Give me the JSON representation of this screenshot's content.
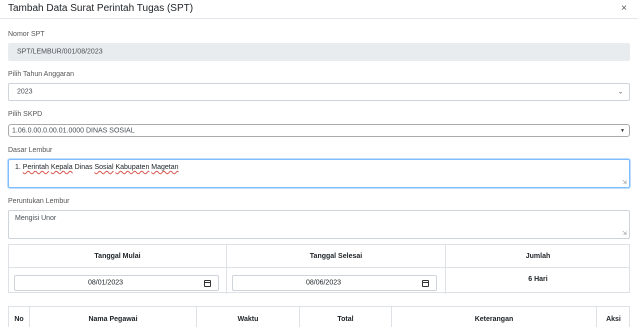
{
  "modal": {
    "title": "Tambah Data Surat Perintah Tugas (SPT)",
    "close_icon": "×"
  },
  "nomor_spt": {
    "label": "Nomor SPT",
    "value": "SPT/LEMBUR/001/08/2023"
  },
  "tahun_anggaran": {
    "label": "Pilih Tahun Anggaran",
    "value": "2023"
  },
  "skpd": {
    "label": "Pilih SKPD",
    "value": "1.06.0.00.0.00.01.0000 DINAS SOSIAL"
  },
  "dasar_lembur": {
    "label": "Dasar Lembur",
    "prefix": "1.",
    "words": [
      "Perintah",
      "Kepala",
      "Dinas",
      "Sosial",
      "Kabupaten",
      "Magetan"
    ]
  },
  "peruntukan_lembur": {
    "label": "Peruntukan Lembur",
    "value": "Mengisi Unor"
  },
  "date_table": {
    "headers": {
      "mulai": "Tanggal Mulai",
      "selesai": "Tanggal Selesai",
      "jumlah": "Jumlah"
    },
    "tanggal_mulai": "08/01/2023",
    "tanggal_selesai": "08/06/2023",
    "jumlah_value": "6 Hari"
  },
  "pegawai_table": {
    "headers": [
      "No",
      "Nama Pegawai",
      "Waktu",
      "Total",
      "Keterangan",
      "Aksi"
    ]
  }
}
